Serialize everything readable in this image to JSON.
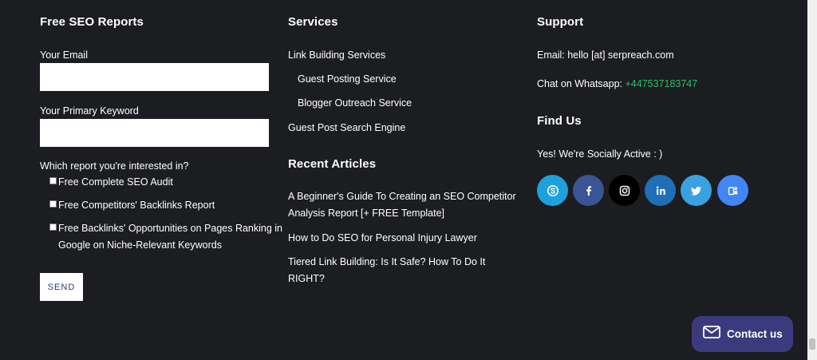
{
  "seo_reports": {
    "heading": "Free SEO Reports",
    "email_label": "Your Email",
    "email_value": "",
    "keyword_label": "Your Primary Keyword",
    "keyword_value": "",
    "report_question": "Which report you're interested in?",
    "options": [
      {
        "label": "Free Complete SEO Audit",
        "checked": false
      },
      {
        "label": "Free Competitors' Backlinks Report",
        "checked": false
      },
      {
        "label": "Free Backlinks' Opportunities on Pages Ranking in Google on Niche-Relevant Keywords",
        "checked": false
      }
    ],
    "send_label": "SEND"
  },
  "services": {
    "heading": "Services",
    "items": [
      {
        "label": "Link Building Services"
      },
      {
        "label": "Guest Posting Service"
      },
      {
        "label": "Blogger Outreach Service"
      },
      {
        "label": "Guest Post Search Engine"
      }
    ]
  },
  "recent_articles": {
    "heading": "Recent Articles",
    "items": [
      {
        "title": "A Beginner's Guide To Creating an SEO Competitor Analysis Report [+ FREE Template]"
      },
      {
        "title": "How to Do SEO for Personal Injury Lawyer"
      },
      {
        "title": "Tiered Link Building: Is It Safe? How To Do It RIGHT?"
      }
    ]
  },
  "support": {
    "heading": "Support",
    "email_text": "Email: hello [at] serpreach.com",
    "whatsapp_prefix": "Chat on Whatsapp: ",
    "whatsapp_number": "+447537183747",
    "whatsapp_color": "#25c26a"
  },
  "find_us": {
    "heading": "Find Us",
    "tagline": "Yes! We're Socially Active : )",
    "socials": [
      {
        "icon": "skype-icon",
        "color": "#1ea0dc"
      },
      {
        "icon": "facebook-icon",
        "color": "#3b5495"
      },
      {
        "icon": "instagram-icon",
        "color": "#000000"
      },
      {
        "icon": "linkedin-icon",
        "color": "#1e6fb5"
      },
      {
        "icon": "twitter-icon",
        "color": "#3aa1e0"
      },
      {
        "icon": "google-my-business-icon",
        "color": "#4285f4"
      }
    ]
  },
  "contact_widget": {
    "label": "Contact us",
    "icon": "envelope-icon",
    "color": "#3c3a7e"
  }
}
